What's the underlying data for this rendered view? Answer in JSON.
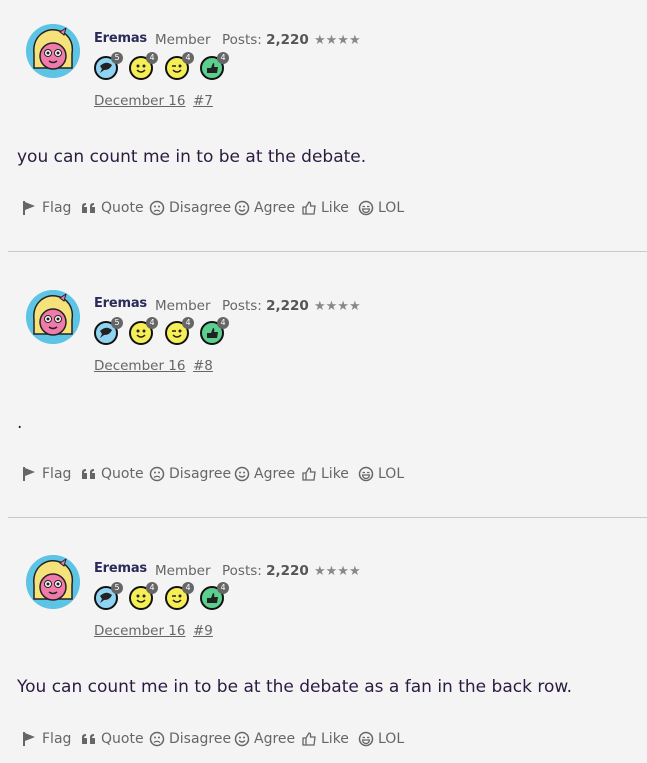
{
  "posts": [
    {
      "username": "Eremas",
      "role": "Member",
      "posts_label": "Posts:",
      "posts_count": "2,220",
      "stars": "★★★★",
      "badges": [
        {
          "icon": "speech-bubble-icon",
          "color": "#8fd3f2",
          "count": "5"
        },
        {
          "icon": "smile-face-icon",
          "color": "#f5ee55",
          "count": "4"
        },
        {
          "icon": "wink-face-icon",
          "color": "#f5ee55",
          "count": "4"
        },
        {
          "icon": "thumbs-up-icon",
          "color": "#5bcf8e",
          "count": "4"
        }
      ],
      "date": "December 16",
      "post_number": "#7",
      "message": "you can count me in to be at the debate."
    },
    {
      "username": "Eremas",
      "role": "Member",
      "posts_label": "Posts:",
      "posts_count": "2,220",
      "stars": "★★★★",
      "badges": [
        {
          "icon": "speech-bubble-icon",
          "color": "#8fd3f2",
          "count": "5"
        },
        {
          "icon": "smile-face-icon",
          "color": "#f5ee55",
          "count": "4"
        },
        {
          "icon": "wink-face-icon",
          "color": "#f5ee55",
          "count": "4"
        },
        {
          "icon": "thumbs-up-icon",
          "color": "#5bcf8e",
          "count": "4"
        }
      ],
      "date": "December 16",
      "post_number": "#8",
      "message": "."
    },
    {
      "username": "Eremas",
      "role": "Member",
      "posts_label": "Posts:",
      "posts_count": "2,220",
      "stars": "★★★★",
      "badges": [
        {
          "icon": "speech-bubble-icon",
          "color": "#8fd3f2",
          "count": "5"
        },
        {
          "icon": "smile-face-icon",
          "color": "#f5ee55",
          "count": "4"
        },
        {
          "icon": "wink-face-icon",
          "color": "#f5ee55",
          "count": "4"
        },
        {
          "icon": "thumbs-up-icon",
          "color": "#5bcf8e",
          "count": "4"
        }
      ],
      "date": "December 16",
      "post_number": "#9",
      "message": "You can count me in to be at the debate as a fan in the back row."
    }
  ],
  "actions": {
    "flag": "Flag",
    "quote": "Quote",
    "disagree": "Disagree",
    "agree": "Agree",
    "like": "Like",
    "lol": "LOL"
  }
}
